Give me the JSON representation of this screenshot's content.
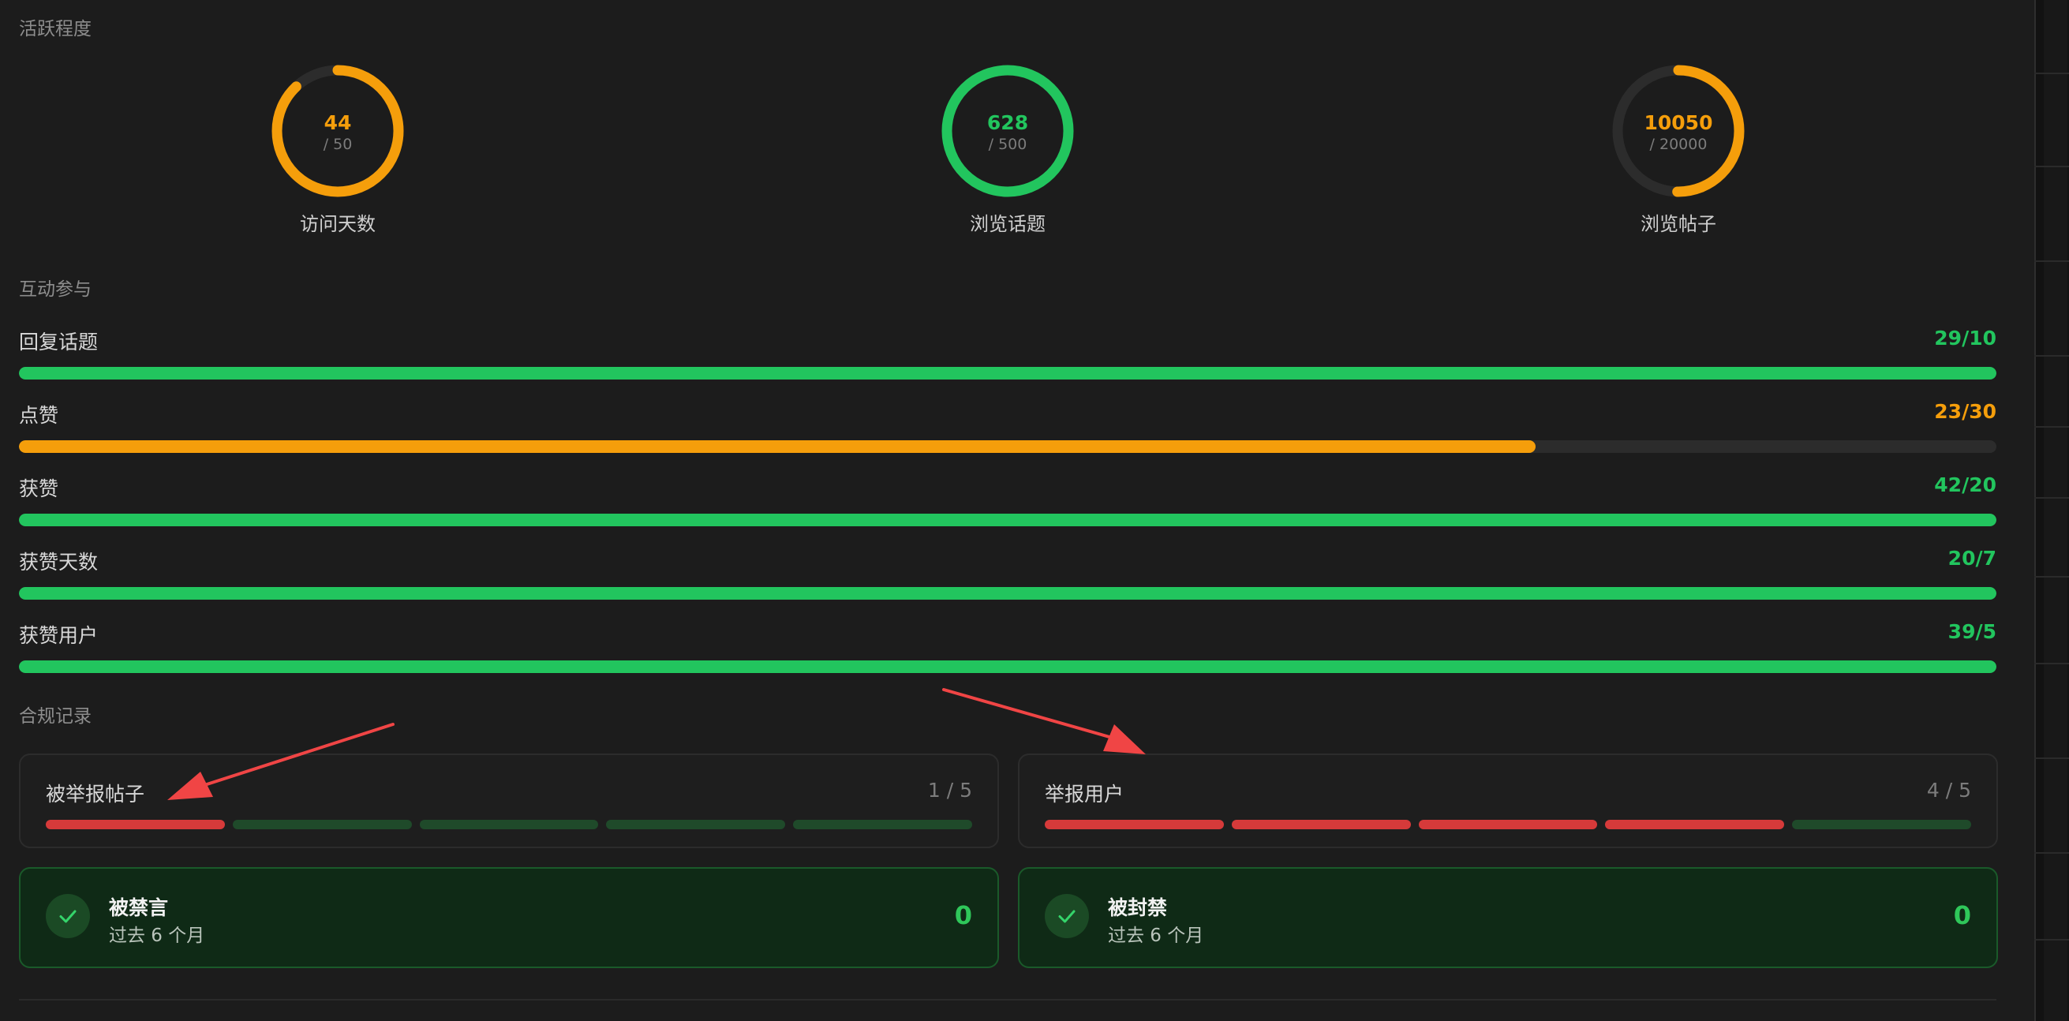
{
  "colors": {
    "green": "#22c55e",
    "orange": "#f59e0b",
    "red": "#d63a3a",
    "seg_inactive": "#1f4a2a"
  },
  "sections": {
    "activity_title": "活跃程度",
    "interaction_title": "互动参与",
    "compliance_title": "合规记录"
  },
  "rings": [
    {
      "value": "44",
      "target": "/ 50",
      "label": "访问天数",
      "progress": 0.88,
      "color": "#f59e0b"
    },
    {
      "value": "628",
      "target": "/ 500",
      "label": "浏览话题",
      "progress": 1.0,
      "color": "#22c55e"
    },
    {
      "value": "10050",
      "target": "/ 20000",
      "label": "浏览帖子",
      "progress": 0.5025,
      "color": "#f59e0b"
    }
  ],
  "bars": [
    {
      "label": "回复话题",
      "value": "29/10",
      "progress": 1.0,
      "color": "#22c55e"
    },
    {
      "label": "点赞",
      "value": "23/30",
      "progress": 0.767,
      "color": "#f59e0b"
    },
    {
      "label": "获赞",
      "value": "42/20",
      "progress": 1.0,
      "color": "#22c55e"
    },
    {
      "label": "获赞天数",
      "value": "20/7",
      "progress": 1.0,
      "color": "#22c55e"
    },
    {
      "label": "获赞用户",
      "value": "39/5",
      "progress": 1.0,
      "color": "#22c55e"
    }
  ],
  "reports": [
    {
      "label": "被举报帖子",
      "count": "1 / 5",
      "filled": 1,
      "total": 5
    },
    {
      "label": "举报用户",
      "count": "4 / 5",
      "filled": 4,
      "total": 5
    }
  ],
  "penalties": [
    {
      "title": "被禁言",
      "subtitle": "过去 6 个月",
      "value": "0",
      "icon": "check-icon"
    },
    {
      "title": "被封禁",
      "subtitle": "过去 6 个月",
      "value": "0",
      "icon": "check-icon"
    }
  ]
}
